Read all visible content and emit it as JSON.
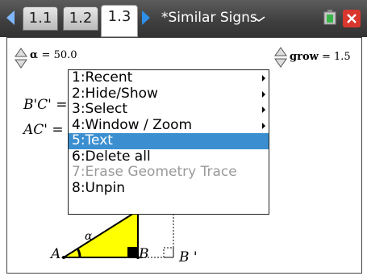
{
  "tabs": [
    {
      "label": "1.1"
    },
    {
      "label": "1.2"
    },
    {
      "label": "1.3"
    }
  ],
  "document": {
    "title": "*Similar Signs"
  },
  "sliders": {
    "alpha": {
      "name": "α",
      "value": "= 50.0"
    },
    "grow": {
      "name": "grow",
      "value": "= 1.5"
    }
  },
  "canvas": {
    "bc_label": "B'C' =",
    "ac_label": "AC' =",
    "point_a": "A",
    "point_b": "B",
    "point_b_prime": "B '",
    "angle_label": "α"
  },
  "context_menu": {
    "items": [
      {
        "label": "1:Recent",
        "submenu": true,
        "state": "normal"
      },
      {
        "label": "2:Hide/Show",
        "submenu": true,
        "state": "normal"
      },
      {
        "label": "3:Select",
        "submenu": true,
        "state": "normal"
      },
      {
        "label": "4:Window / Zoom",
        "submenu": true,
        "state": "normal"
      },
      {
        "label": "5:Text",
        "submenu": false,
        "state": "selected"
      },
      {
        "label": "6:Delete all",
        "submenu": false,
        "state": "normal"
      },
      {
        "label": "7:Erase Geometry Trace",
        "submenu": false,
        "state": "disabled"
      },
      {
        "label": "8:Unpin",
        "submenu": false,
        "state": "normal"
      }
    ]
  },
  "colors": {
    "selection": "#3b8fd0",
    "triangle_fill": "#ffff00",
    "tab_arrow_left": "#7fb7ff",
    "tab_arrow_right": "#2d8fe8",
    "close_button": "#d9362d"
  }
}
